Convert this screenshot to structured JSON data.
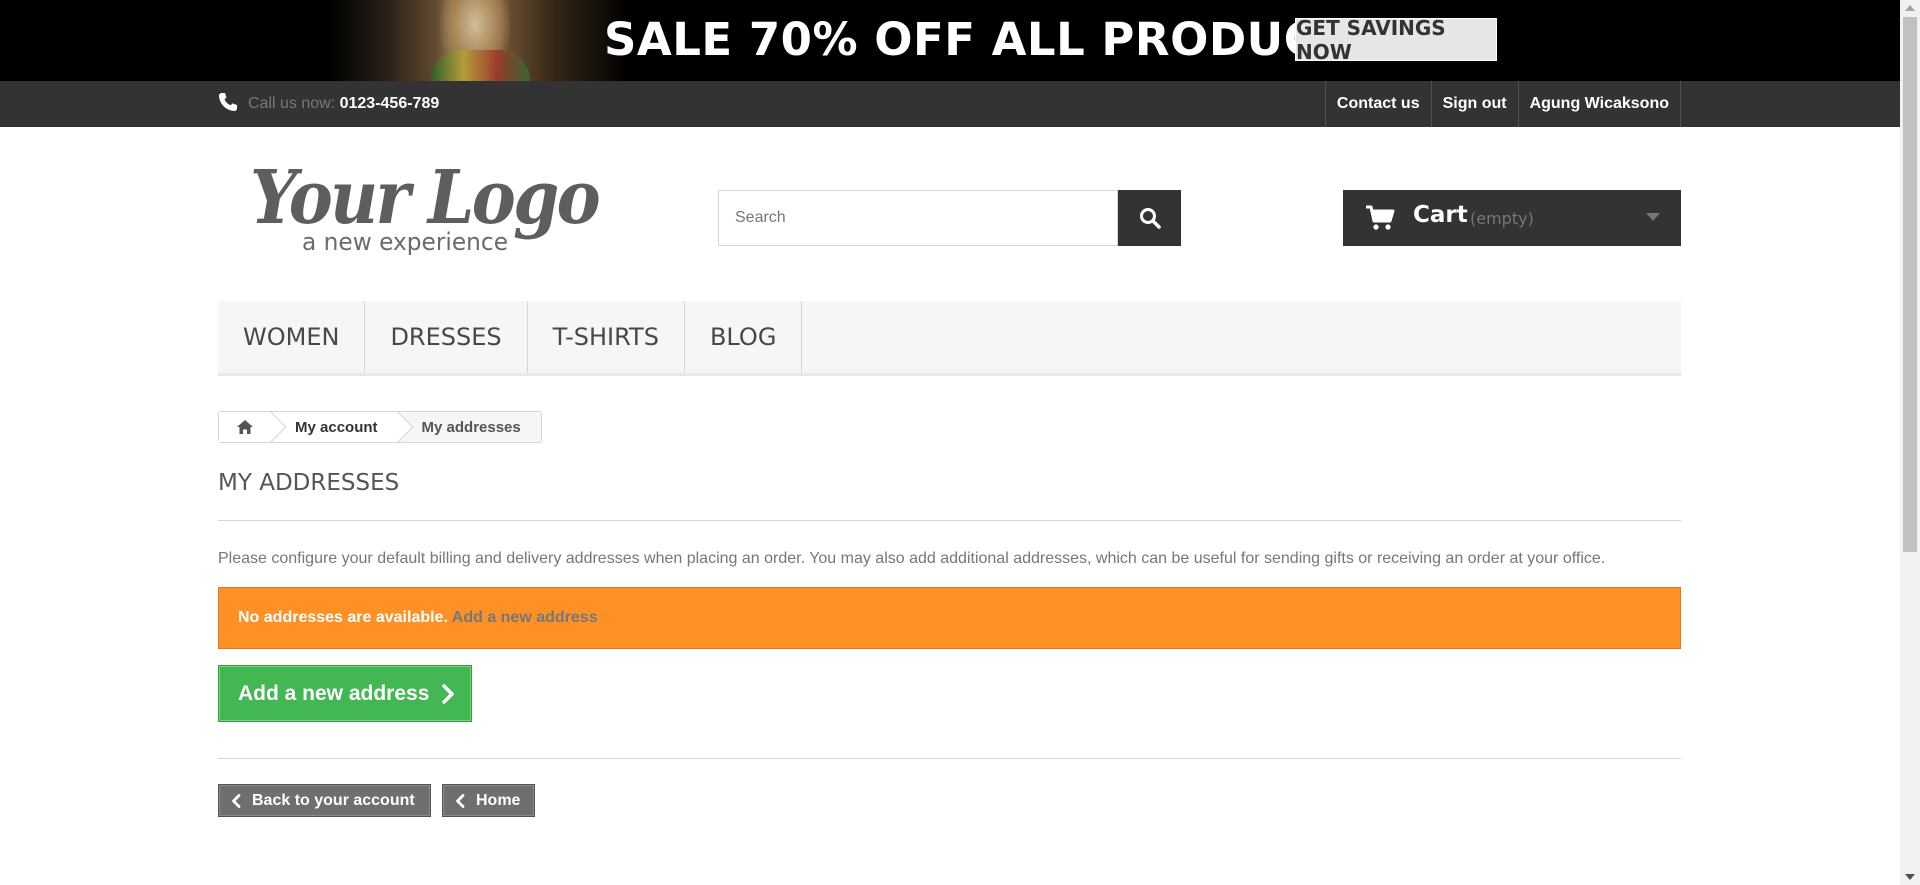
{
  "banner": {
    "headline": "SALE 70% OFF ALL PRODUCTS",
    "button_label": "GET SAVINGS NOW"
  },
  "topbar": {
    "call_prefix": "Call us now: ",
    "phone": "0123-456-789",
    "links": {
      "contact": "Contact us",
      "signout": "Sign out",
      "user": "Agung Wicaksono"
    }
  },
  "header": {
    "logo_main": "Your Logo",
    "logo_tagline": "a new experience",
    "search_placeholder": "Search",
    "search_value": "",
    "cart_label": "Cart",
    "cart_status": "(empty)"
  },
  "menu": {
    "items": [
      "WOMEN",
      "DRESSES",
      "T-SHIRTS",
      "BLOG"
    ]
  },
  "breadcrumb": {
    "account": "My account",
    "current": "My addresses"
  },
  "content": {
    "title": "MY ADDRESSES",
    "intro": "Please configure your default billing and delivery addresses when placing an order. You may also add additional addresses, which can be useful for sending gifts or receiving an order at your office.",
    "alert_text": "No addresses are available.",
    "alert_link": "Add a new address",
    "add_button": "Add a new address",
    "back_button": "Back to your account",
    "home_button": "Home"
  },
  "colors": {
    "dark_bar": "#333333",
    "alert_orange": "#fe9126",
    "add_green": "#43b754",
    "nav_button_gray": "#6f6f6f"
  }
}
